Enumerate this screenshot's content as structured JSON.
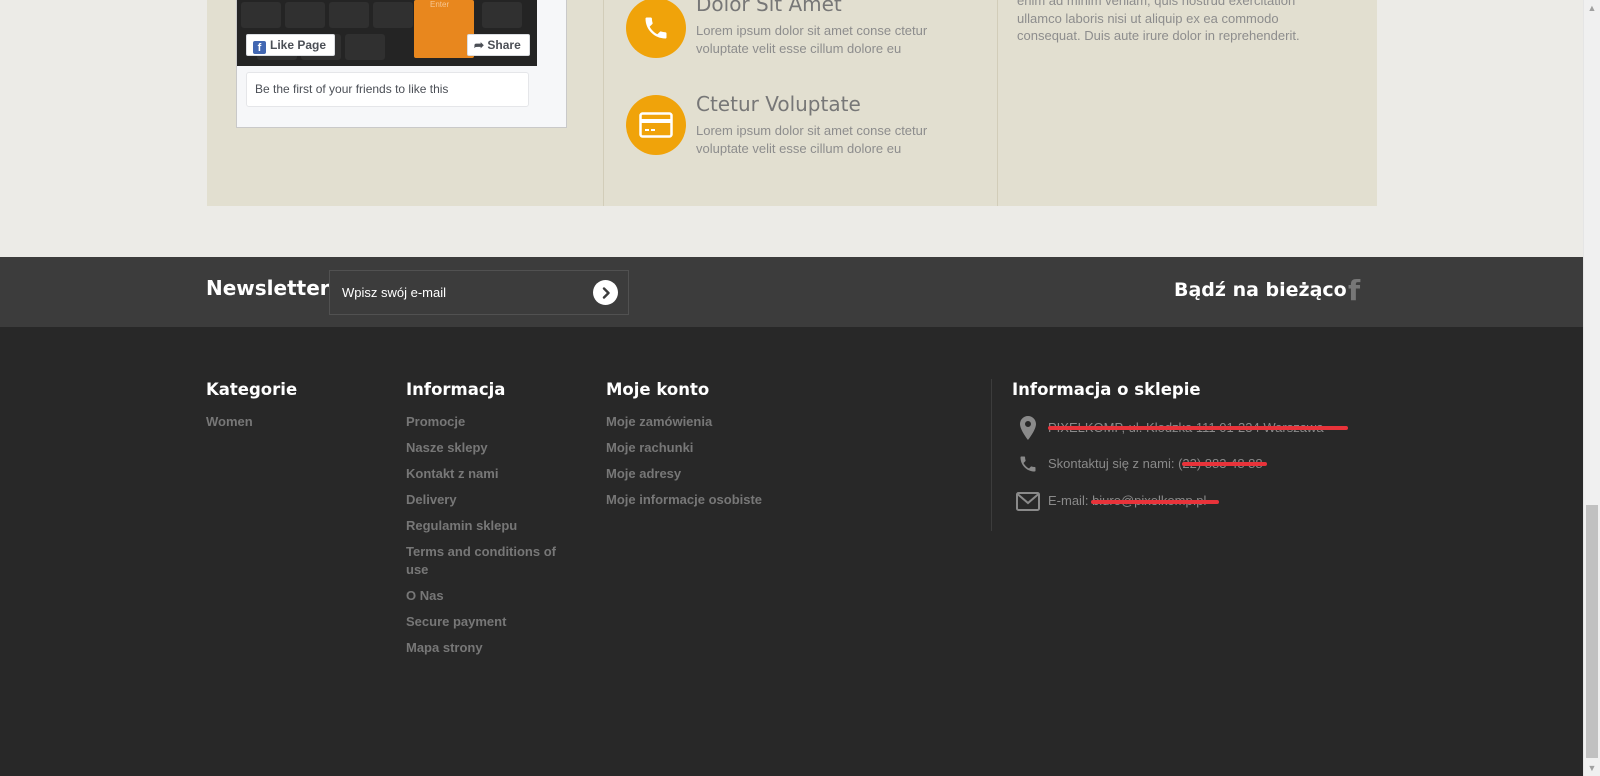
{
  "facebook": {
    "key_label": "Enter",
    "like_label": "Like Page",
    "share_label": "Share",
    "friends_text": "Be the first of your friends to like this"
  },
  "features": [
    {
      "icon": "phone-icon",
      "title": "Dolor Sit Amet",
      "text": "Lorem ipsum dolor sit amet conse ctetur voluptate velit esse cillum dolore eu"
    },
    {
      "icon": "credit-card-icon",
      "title": "Ctetur Voluptate",
      "text": "Lorem ipsum dolor sit amet conse ctetur voluptate velit esse cillum dolore eu"
    }
  ],
  "about_text": "enim ad minim veniam, quis nostrud exercitation ullamco laboris nisi ut aliquip ex ea commodo consequat. Duis aute irure dolor in reprehenderit.",
  "newsletter": {
    "title": "Newsletter",
    "placeholder": "Wpisz swój e-mail",
    "follow_label": "Bądź na bieżąco"
  },
  "footer": {
    "categories": {
      "title": "Kategorie",
      "items": [
        "Women"
      ]
    },
    "info": {
      "title": "Informacja",
      "items": [
        "Promocje",
        "Nasze sklepy",
        "Kontakt z nami",
        "Delivery",
        "Regulamin sklepu",
        "Terms and conditions of use",
        "O Nas",
        "Secure payment",
        "Mapa strony"
      ]
    },
    "account": {
      "title": "Moje konto",
      "items": [
        "Moje zamówienia",
        "Moje rachunki",
        "Moje adresy",
        "Moje informacje osobiste"
      ]
    },
    "store": {
      "title": "Informacja o sklepie",
      "address": "PIXELKOMP, ul. Kłodzka 111 01-234 Warszawa",
      "contact_label": "Skontaktuj się z nami: ",
      "phone": "(22) 883 48 88",
      "email_label": "E-mail: ",
      "email": "biuro@pixelkomp.pl"
    }
  },
  "colors": {
    "accent": "#f0a30a",
    "panel": "#e2dfd0",
    "footer": "#282828",
    "newsletter_bar": "#3c3c3c",
    "redaction": "#e8333a"
  }
}
